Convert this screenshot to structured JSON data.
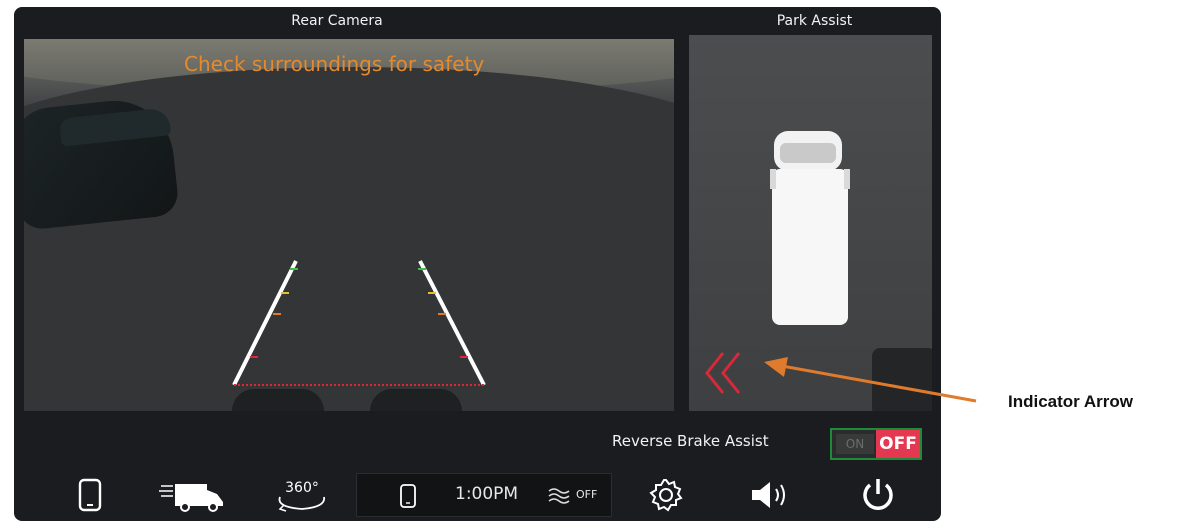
{
  "screen": {
    "rear_camera_title": "Rear Camera",
    "park_assist_title": "Park Assist",
    "warning_text": "Check surroundings for safety",
    "reverse_brake_assist_label": "Reverse Brake Assist",
    "toggle": {
      "on_label": "ON",
      "off_label": "OFF",
      "state": "OFF"
    },
    "status": {
      "time": "1:00PM",
      "climate_label": "OFF"
    }
  },
  "icons": {
    "phone": "phone-icon",
    "trailer": "van-icon",
    "camera360": "360-camera-icon",
    "status_phone": "phone-status-icon",
    "climate": "heat-waves-icon",
    "settings": "gear-icon",
    "volume": "speaker-icon",
    "power": "power-icon"
  },
  "labels": {
    "camera360": "360°"
  },
  "annotation": {
    "callout_text": "Indicator Arrow"
  },
  "colors": {
    "warning": "#e58a2f",
    "indicator_arrow": "#d8283a",
    "callout_arrow": "#e07a2c",
    "toggle_off": "#e3384f",
    "toggle_border": "#1f8a3a"
  }
}
